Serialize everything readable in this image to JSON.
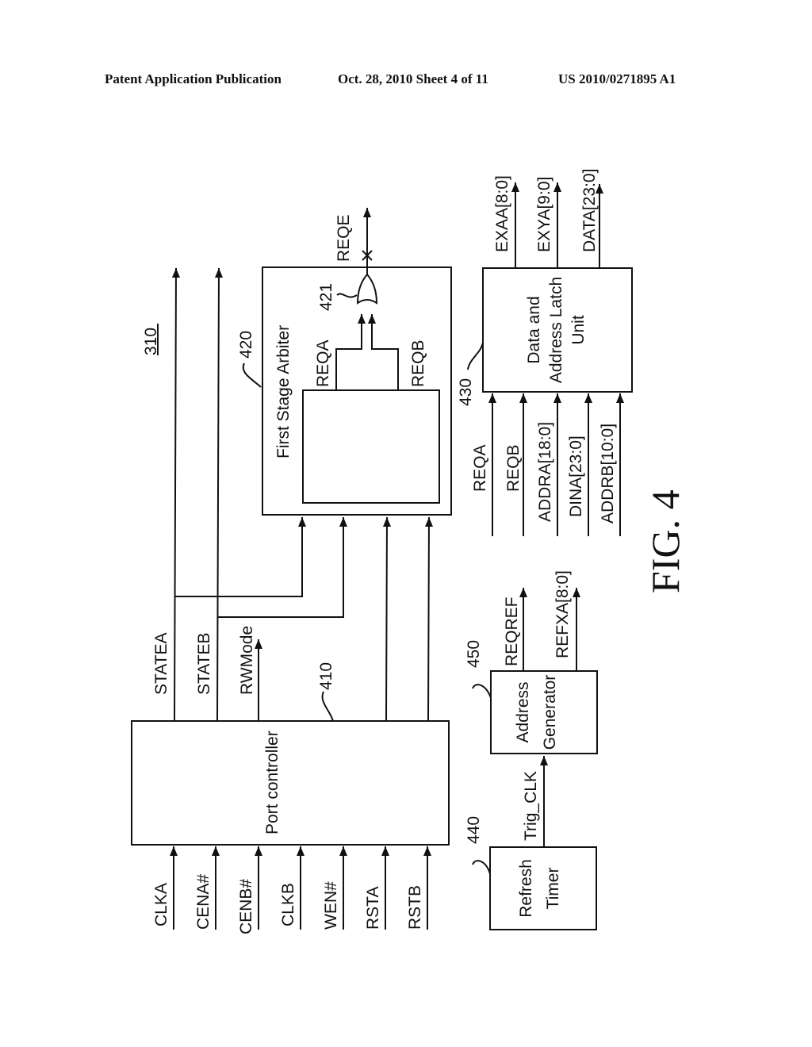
{
  "header": {
    "publication": "Patent Application Publication",
    "date_sheet": "Oct. 28, 2010   Sheet 4 of 11",
    "number": "US 2010/0271895 A1"
  },
  "figure": {
    "label": "FIG. 4",
    "ref_main": "310",
    "blocks": {
      "port_controller": {
        "name": "Port controller",
        "ref": "410"
      },
      "arbiter": {
        "name": "First Stage Arbiter",
        "ref": "420",
        "gate_ref": "421",
        "inner_out_a": "REQA",
        "inner_out_b": "REQB",
        "output": "REQE"
      },
      "latch": {
        "line1": "Data and",
        "line2": "Address Latch",
        "line3": "Unit",
        "ref": "430"
      },
      "timer": {
        "line1": "Refresh",
        "line2": "Timer",
        "ref": "440"
      },
      "addrgen": {
        "line1": "Address",
        "line2": "Generator",
        "ref": "450"
      }
    },
    "port_inputs": [
      "CLKA",
      "CENA#",
      "CENB#",
      "CLKB",
      "WEN#",
      "RSTA",
      "RSTB"
    ],
    "port_outputs": [
      "STATEA",
      "STATEB",
      "RWMode"
    ],
    "latch_inputs": [
      "REQA",
      "REQB",
      "ADDRA[18:0]",
      "DINA[23:0]",
      "ADDRB[10:0]"
    ],
    "latch_outputs": [
      "EXAA[8:0]",
      "EXYA[9:0]",
      "DATA[23:0]"
    ],
    "timer_output": "Trig_CLK",
    "addrgen_outputs": [
      "REQREF",
      "REFXA[8:0]"
    ]
  }
}
